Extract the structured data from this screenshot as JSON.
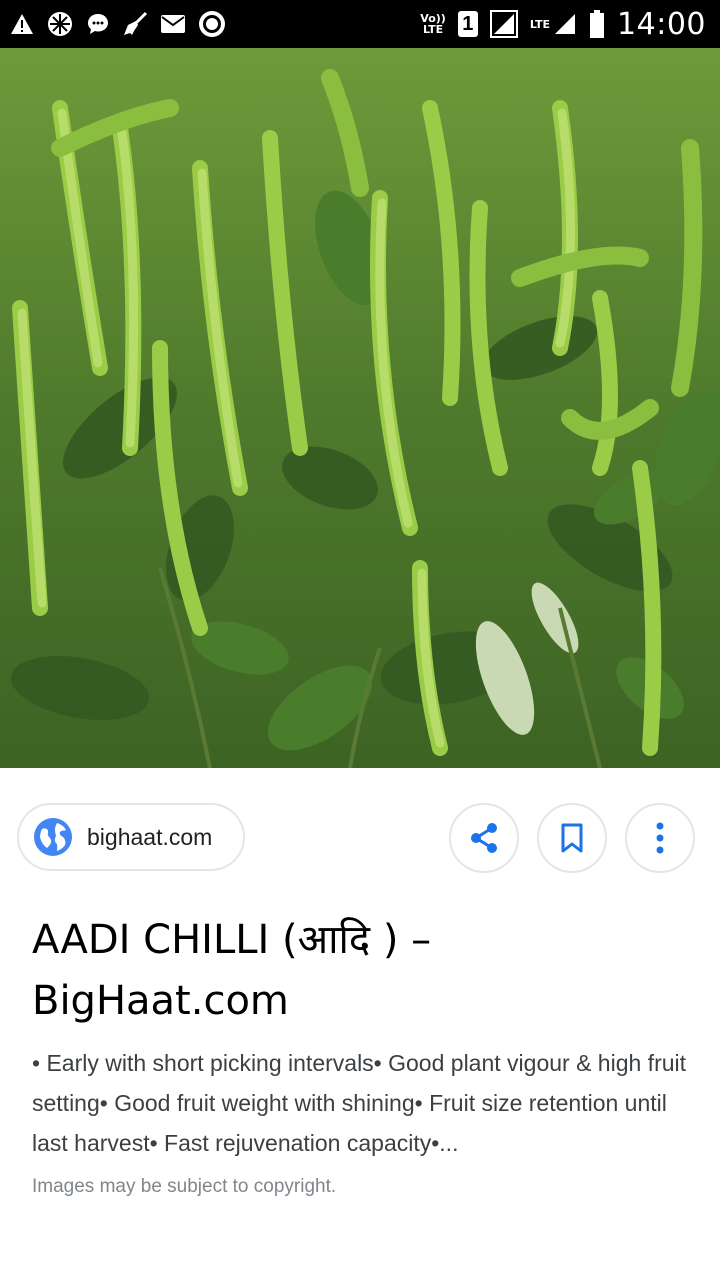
{
  "status_bar": {
    "time": "14:00",
    "sim_slot": "1",
    "volte_top": "Vo))",
    "volte_bottom": "LTE",
    "lte_label": "LTE",
    "icons_left": [
      "warning-icon",
      "crosshair-icon",
      "chat-icon",
      "broom-icon",
      "mail-icon",
      "record-icon"
    ],
    "icons_right": [
      "volte-icon",
      "sim-icon",
      "signal-icon",
      "lte-signal-icon",
      "battery-icon"
    ]
  },
  "image": {
    "subject": "green chilli plants"
  },
  "source": {
    "domain": "bighaat.com",
    "icon": "globe-icon"
  },
  "actions": {
    "share_icon": "share-icon",
    "save_icon": "bookmark-icon",
    "more_icon": "more-vertical-icon"
  },
  "result": {
    "title": "AADI CHILLI (आदि ) – BigHaat.com",
    "description": "• Early with short picking intervals• Good plant vigour & high fruit setting• Good fruit weight with shining• Fruit size retention until last harvest• Fast rejuvenation capacity•...",
    "copyright": "Images may be subject to copyright."
  },
  "colors": {
    "link_blue": "#1a73e8",
    "border": "#e3e5e8",
    "title_text": "#000000",
    "body_text": "#3c4043",
    "muted_text": "#80868b"
  }
}
